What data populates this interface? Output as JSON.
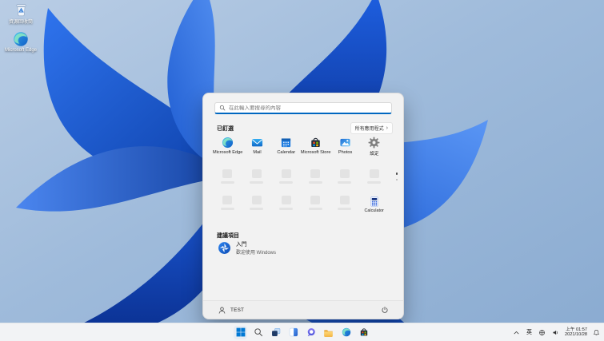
{
  "colors": {
    "accent": "#0067c0",
    "menu_bg": "#f2f2f2",
    "taskbar_bg": "#f2f3f5",
    "skeleton": "#e3e3e3",
    "wallpaper_sky": "#9cb9da",
    "wallpaper_bloom_dark": "#0c3fa8",
    "wallpaper_bloom_light": "#5a96f5"
  },
  "desktop": {
    "icons": [
      {
        "label": "資源回收筒",
        "icon": "recycle-bin-icon"
      },
      {
        "label": "Microsoft Edge",
        "icon": "edge-icon"
      }
    ]
  },
  "start_menu": {
    "search": {
      "placeholder": "在此輸入要搜尋的內容",
      "icon": "search-icon"
    },
    "pinned": {
      "title": "已釘選",
      "all_apps_label": "所有應用程式",
      "all_apps_chevron": "›",
      "apps": [
        {
          "label": "Microsoft Edge",
          "icon": "edge-icon"
        },
        {
          "label": "Mail",
          "icon": "mail-icon"
        },
        {
          "label": "Calendar",
          "icon": "calendar-icon"
        },
        {
          "label": "Microsoft Store",
          "icon": "store-icon"
        },
        {
          "label": "Photos",
          "icon": "photos-icon"
        },
        {
          "label": "設定",
          "icon": "settings-gear-icon"
        }
      ],
      "loading_tiles_row2": 6,
      "loading_tiles_row3": 5,
      "calculator": {
        "label": "Calculator",
        "icon": "calculator-icon"
      },
      "page_count": 2,
      "current_page": 1
    },
    "recommended": {
      "title": "建議項目",
      "items": [
        {
          "title": "入門",
          "subtitle": "歡迎使用 Windows",
          "icon": "get-started-icon"
        }
      ]
    },
    "footer": {
      "user": "TEST",
      "power_icon": "power-icon",
      "user_icon": "person-icon"
    }
  },
  "taskbar": {
    "buttons": [
      {
        "name": "start",
        "icon": "windows-logo-icon",
        "active": true
      },
      {
        "name": "search",
        "icon": "search-icon"
      },
      {
        "name": "task-view",
        "icon": "task-view-icon"
      },
      {
        "name": "widgets",
        "icon": "widgets-icon"
      },
      {
        "name": "chat",
        "icon": "chat-icon"
      },
      {
        "name": "file-explorer",
        "icon": "folder-icon"
      },
      {
        "name": "edge",
        "icon": "edge-icon"
      },
      {
        "name": "store",
        "icon": "store-icon"
      }
    ],
    "tray": {
      "hidden_icons_chevron": "chevron-up-icon",
      "ime": "英",
      "network_icon": "globe-icon",
      "volume_icon": "speaker-icon",
      "time": "上午 01:57",
      "date": "2021/10/28",
      "notifications_icon": "bell-icon"
    }
  }
}
